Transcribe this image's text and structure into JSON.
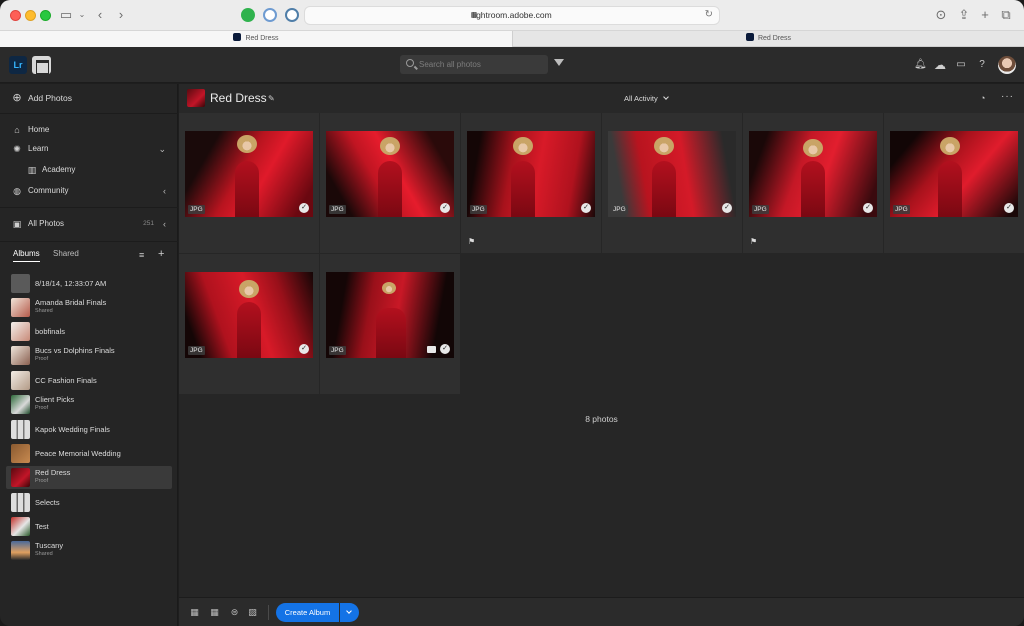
{
  "browser": {
    "url": "lightroom.adobe.com",
    "tabs": [
      {
        "label": "Red Dress",
        "active": true
      },
      {
        "label": "Red Dress",
        "active": false
      }
    ]
  },
  "topbar": {
    "search_placeholder": "Search all photos"
  },
  "sidebar": {
    "add_photos": "Add Photos",
    "nav": [
      {
        "label": "Home",
        "icon": "home-icon"
      },
      {
        "label": "Learn",
        "icon": "lightbulb-icon"
      },
      {
        "label": "Academy",
        "icon": "books-icon"
      },
      {
        "label": "Community",
        "icon": "globe-icon"
      }
    ],
    "all_photos": {
      "label": "All Photos",
      "count": "251"
    },
    "album_tabs": [
      "Albums",
      "Shared"
    ],
    "albums": [
      {
        "name": "8/18/14, 12:33:07 AM",
        "sub": ""
      },
      {
        "name": "Amanda Bridal Finals",
        "sub": "Shared"
      },
      {
        "name": "bobfinals",
        "sub": ""
      },
      {
        "name": "Bucs vs Dolphins Finals",
        "sub": "Proof"
      },
      {
        "name": "CC Fashion Finals",
        "sub": ""
      },
      {
        "name": "Client Picks",
        "sub": "Proof"
      },
      {
        "name": "Kapok Wedding Finals",
        "sub": ""
      },
      {
        "name": "Peace Memorial Wedding",
        "sub": ""
      },
      {
        "name": "Red Dress",
        "sub": "Proof"
      },
      {
        "name": "Selects",
        "sub": ""
      },
      {
        "name": "Test",
        "sub": ""
      },
      {
        "name": "Tuscany",
        "sub": "Shared"
      }
    ]
  },
  "main": {
    "title": "Red Dress",
    "activity": "All Activity",
    "photos": [
      {
        "badge": "JPG",
        "flag": false,
        "comment": false
      },
      {
        "badge": "JPG",
        "flag": false,
        "comment": false
      },
      {
        "badge": "JPG",
        "flag": true,
        "comment": false
      },
      {
        "badge": "JPG",
        "flag": false,
        "comment": false
      },
      {
        "badge": "JPG",
        "flag": true,
        "comment": false
      },
      {
        "badge": "JPG",
        "flag": false,
        "comment": false
      },
      {
        "badge": "JPG",
        "flag": false,
        "comment": false
      },
      {
        "badge": "JPG",
        "flag": false,
        "comment": true
      }
    ],
    "count_label": "8 photos",
    "create_album": "Create Album"
  }
}
